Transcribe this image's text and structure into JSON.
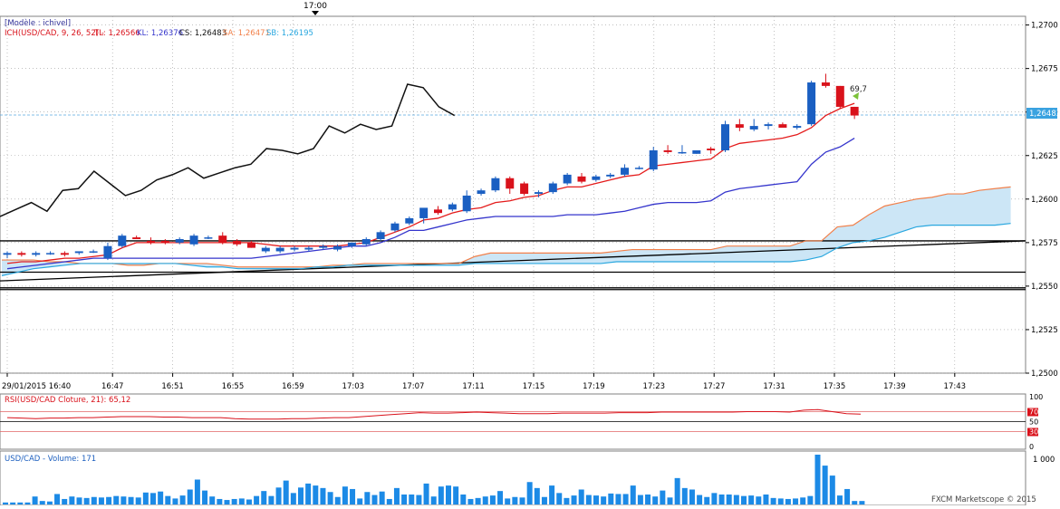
{
  "top_marker": {
    "label": "17:00",
    "time_index": 23
  },
  "legend": {
    "model": "[Modèle : ichivel]",
    "ich": "ICH(USD/CAD, 9, 26, 52) -",
    "tl": "TL: 1,26566",
    "kl": "KL: 1,26376",
    "cs": "CS: 1,26483",
    "sa": "SA: 1,26471",
    "sb": "SB: 1,26195"
  },
  "colors": {
    "bull": "#1a5fc2",
    "bear": "#d9121b",
    "tenkan": "#e41b1b",
    "kijun": "#3535cc",
    "chikou": "#111111",
    "senkou_a": "#f2804a",
    "senkou_b": "#29a7df",
    "cloud": "#cce6f6",
    "rsi": "#d9121b",
    "volume": "#1c8ae6",
    "grid": "#9a9a9a",
    "price_badge": "#3aa2e0"
  },
  "price_label": "1,26483",
  "rsi_legend": "RSI(USD/CAD Cloture, 21): 65,12",
  "volume_legend": "USD/CAD - Volume: 171",
  "volume_axis_label": "1 000",
  "footer": "FXCM Marketscope © 2015",
  "annotation": "69,7",
  "chart_data": [
    {
      "type": "candlestick",
      "title": "",
      "x_labels": [
        {
          "i": 0,
          "label": "29/01/2015 16:40"
        },
        {
          "i": 7,
          "label": "16:47"
        },
        {
          "i": 11,
          "label": "16:51"
        },
        {
          "i": 15,
          "label": "16:55"
        },
        {
          "i": 19,
          "label": "16:59"
        },
        {
          "i": 23,
          "label": "17:03"
        },
        {
          "i": 27,
          "label": "17:07"
        },
        {
          "i": 31,
          "label": "17:11"
        },
        {
          "i": 35,
          "label": "17:15"
        },
        {
          "i": 39,
          "label": "17:19"
        },
        {
          "i": 43,
          "label": "17:23"
        },
        {
          "i": 47,
          "label": "17:27"
        },
        {
          "i": 51,
          "label": "17:31"
        },
        {
          "i": 55,
          "label": "17:35"
        },
        {
          "i": 59,
          "label": "17:39"
        },
        {
          "i": 63,
          "label": "17:43"
        }
      ],
      "y_ticks": [
        "1,2700",
        "1,2675",
        "1,2650",
        "1,2625",
        "1,2600",
        "1,2575",
        "1,2550",
        "1,2525",
        "1,2500"
      ],
      "y_tick_values": [
        1.27,
        1.2675,
        1.265,
        1.2625,
        1.26,
        1.2575,
        1.255,
        1.2525,
        1.25
      ],
      "ylim": [
        1.25,
        1.2705
      ],
      "x_count": 66,
      "candles": [
        {
          "o": 1.2568,
          "h": 1.257,
          "l": 1.2566,
          "c": 1.2569
        },
        {
          "o": 1.2569,
          "h": 1.257,
          "l": 1.2567,
          "c": 1.2568
        },
        {
          "o": 1.2568,
          "h": 1.257,
          "l": 1.2567,
          "c": 1.2569
        },
        {
          "o": 1.2569,
          "h": 1.257,
          "l": 1.2568,
          "c": 1.2569
        },
        {
          "o": 1.2569,
          "h": 1.257,
          "l": 1.2567,
          "c": 1.2568
        },
        {
          "o": 1.2569,
          "h": 1.257,
          "l": 1.2568,
          "c": 1.257
        },
        {
          "o": 1.257,
          "h": 1.2571,
          "l": 1.2569,
          "c": 1.257
        },
        {
          "o": 1.2566,
          "h": 1.2575,
          "l": 1.2565,
          "c": 1.2573
        },
        {
          "o": 1.2573,
          "h": 1.258,
          "l": 1.2572,
          "c": 1.2579
        },
        {
          "o": 1.2578,
          "h": 1.2579,
          "l": 1.2577,
          "c": 1.2577
        },
        {
          "o": 1.2576,
          "h": 1.2578,
          "l": 1.2574,
          "c": 1.2575
        },
        {
          "o": 1.2576,
          "h": 1.2577,
          "l": 1.2574,
          "c": 1.2575
        },
        {
          "o": 1.2575,
          "h": 1.2578,
          "l": 1.2574,
          "c": 1.2577
        },
        {
          "o": 1.2574,
          "h": 1.258,
          "l": 1.2573,
          "c": 1.2579
        },
        {
          "o": 1.2578,
          "h": 1.2579,
          "l": 1.2577,
          "c": 1.2578
        },
        {
          "o": 1.2579,
          "h": 1.2581,
          "l": 1.2574,
          "c": 1.2575
        },
        {
          "o": 1.2576,
          "h": 1.2577,
          "l": 1.2573,
          "c": 1.2574
        },
        {
          "o": 1.2575,
          "h": 1.2576,
          "l": 1.2572,
          "c": 1.2572
        },
        {
          "o": 1.257,
          "h": 1.2573,
          "l": 1.2569,
          "c": 1.2572
        },
        {
          "o": 1.257,
          "h": 1.2573,
          "l": 1.2569,
          "c": 1.2572
        },
        {
          "o": 1.2571,
          "h": 1.2573,
          "l": 1.257,
          "c": 1.2572
        },
        {
          "o": 1.2571,
          "h": 1.2573,
          "l": 1.257,
          "c": 1.2572
        },
        {
          "o": 1.2572,
          "h": 1.2574,
          "l": 1.2571,
          "c": 1.2573
        },
        {
          "o": 1.2571,
          "h": 1.2574,
          "l": 1.257,
          "c": 1.2573
        },
        {
          "o": 1.2573,
          "h": 1.2575,
          "l": 1.2572,
          "c": 1.2575
        },
        {
          "o": 1.2574,
          "h": 1.2578,
          "l": 1.2573,
          "c": 1.2577
        },
        {
          "o": 1.2577,
          "h": 1.2582,
          "l": 1.2576,
          "c": 1.2581
        },
        {
          "o": 1.2582,
          "h": 1.2587,
          "l": 1.2581,
          "c": 1.2586
        },
        {
          "o": 1.2586,
          "h": 1.259,
          "l": 1.2585,
          "c": 1.2589
        },
        {
          "o": 1.2589,
          "h": 1.2593,
          "l": 1.2586,
          "c": 1.2595
        },
        {
          "o": 1.2594,
          "h": 1.2596,
          "l": 1.2591,
          "c": 1.2592
        },
        {
          "o": 1.2594,
          "h": 1.2598,
          "l": 1.2593,
          "c": 1.2597
        },
        {
          "o": 1.2593,
          "h": 1.2605,
          "l": 1.2592,
          "c": 1.2602
        },
        {
          "o": 1.2603,
          "h": 1.2606,
          "l": 1.2602,
          "c": 1.2605
        },
        {
          "o": 1.2605,
          "h": 1.2613,
          "l": 1.2604,
          "c": 1.2612
        },
        {
          "o": 1.2612,
          "h": 1.2613,
          "l": 1.2603,
          "c": 1.2606
        },
        {
          "o": 1.2609,
          "h": 1.261,
          "l": 1.2602,
          "c": 1.2603
        },
        {
          "o": 1.2603,
          "h": 1.2605,
          "l": 1.2601,
          "c": 1.2604
        },
        {
          "o": 1.2604,
          "h": 1.261,
          "l": 1.2603,
          "c": 1.2609
        },
        {
          "o": 1.2609,
          "h": 1.2615,
          "l": 1.2608,
          "c": 1.2614
        },
        {
          "o": 1.2613,
          "h": 1.2615,
          "l": 1.2609,
          "c": 1.261
        },
        {
          "o": 1.2611,
          "h": 1.2614,
          "l": 1.261,
          "c": 1.2613
        },
        {
          "o": 1.2613,
          "h": 1.2615,
          "l": 1.2612,
          "c": 1.2614
        },
        {
          "o": 1.2614,
          "h": 1.262,
          "l": 1.2613,
          "c": 1.2618
        },
        {
          "o": 1.2618,
          "h": 1.2619,
          "l": 1.2617,
          "c": 1.2618
        },
        {
          "o": 1.2617,
          "h": 1.263,
          "l": 1.2616,
          "c": 1.2628
        },
        {
          "o": 1.2628,
          "h": 1.2631,
          "l": 1.2626,
          "c": 1.2627
        },
        {
          "o": 1.2627,
          "h": 1.2631,
          "l": 1.2626,
          "c": 1.2627
        },
        {
          "o": 1.2626,
          "h": 1.2628,
          "l": 1.2626,
          "c": 1.2628
        },
        {
          "o": 1.2629,
          "h": 1.263,
          "l": 1.2626,
          "c": 1.2628
        },
        {
          "o": 1.2628,
          "h": 1.2645,
          "l": 1.2627,
          "c": 1.2643
        },
        {
          "o": 1.2643,
          "h": 1.2646,
          "l": 1.2639,
          "c": 1.2641
        },
        {
          "o": 1.264,
          "h": 1.2646,
          "l": 1.2639,
          "c": 1.2642
        },
        {
          "o": 1.2642,
          "h": 1.2644,
          "l": 1.264,
          "c": 1.2643
        },
        {
          "o": 1.2643,
          "h": 1.2644,
          "l": 1.2641,
          "c": 1.2641
        },
        {
          "o": 1.2641,
          "h": 1.2643,
          "l": 1.264,
          "c": 1.2642
        },
        {
          "o": 1.2643,
          "h": 1.2668,
          "l": 1.2642,
          "c": 1.2667
        },
        {
          "o": 1.2667,
          "h": 1.2672,
          "l": 1.2664,
          "c": 1.2665
        },
        {
          "o": 1.2665,
          "h": 1.2665,
          "l": 1.2652,
          "c": 1.2653
        },
        {
          "o": 1.2653,
          "h": 1.2653,
          "l": 1.2646,
          "c": 1.2648
        }
      ],
      "candle_x_offset": 0,
      "series": [
        {
          "name": "TL",
          "x_start": 0,
          "values": [
            1.2563,
            1.2564,
            1.2564,
            1.2565,
            1.2566,
            1.2566,
            1.2567,
            1.2568,
            1.2572,
            1.2575,
            1.2575,
            1.2575,
            1.2575,
            1.2575,
            1.2575,
            1.2575,
            1.2575,
            1.2575,
            1.2574,
            1.2573,
            1.2573,
            1.2573,
            1.2573,
            1.2573,
            1.2574,
            1.2575,
            1.2578,
            1.2581,
            1.2584,
            1.2588,
            1.2589,
            1.2592,
            1.2594,
            1.2595,
            1.2598,
            1.2599,
            1.2601,
            1.2602,
            1.2605,
            1.2607,
            1.2607,
            1.2609,
            1.2611,
            1.2613,
            1.2614,
            1.2619,
            1.262,
            1.2621,
            1.2622,
            1.2623,
            1.2629,
            1.2632,
            1.2633,
            1.2634,
            1.2635,
            1.2637,
            1.2641,
            1.2648,
            1.2652,
            1.2655
          ]
        },
        {
          "name": "KL",
          "x_start": 0,
          "values": [
            1.256,
            1.2561,
            1.2562,
            1.2563,
            1.2564,
            1.2565,
            1.2566,
            1.2566,
            1.2566,
            1.2566,
            1.2566,
            1.2566,
            1.2566,
            1.2566,
            1.2566,
            1.2566,
            1.2566,
            1.2566,
            1.2567,
            1.2568,
            1.2569,
            1.257,
            1.2571,
            1.2572,
            1.2573,
            1.2573,
            1.2575,
            1.2578,
            1.2582,
            1.2582,
            1.2584,
            1.2586,
            1.2588,
            1.2589,
            1.259,
            1.259,
            1.259,
            1.259,
            1.259,
            1.2591,
            1.2591,
            1.2591,
            1.2592,
            1.2593,
            1.2595,
            1.2597,
            1.2598,
            1.2598,
            1.2598,
            1.2599,
            1.2604,
            1.2606,
            1.2607,
            1.2608,
            1.2609,
            1.261,
            1.262,
            1.2627,
            1.263,
            1.2635
          ]
        },
        {
          "name": "CS",
          "x_start": 0,
          "values": [
            1.259,
            1.2594,
            1.2598,
            1.2593,
            1.2605,
            1.2606,
            1.2616,
            1.2609,
            1.2602,
            1.2605,
            1.2611,
            1.2614,
            1.2618,
            1.2612,
            1.2615,
            1.2618,
            1.262,
            1.2629,
            1.2628,
            1.2626,
            1.2629,
            1.2642,
            1.2638,
            1.2643,
            1.264,
            1.2642,
            1.2666,
            1.2664,
            1.2653,
            1.2648
          ]
        },
        {
          "name": "SA",
          "x_start": 0,
          "values": [
            1.2565,
            1.2565,
            1.2565,
            1.2564,
            1.2564,
            1.2563,
            1.2563,
            1.2563,
            1.2562,
            1.2562,
            1.2563,
            1.2563,
            1.2563,
            1.2563,
            1.2562,
            1.2561,
            1.2561,
            1.2561,
            1.2561,
            1.2561,
            1.2561,
            1.2562,
            1.2562,
            1.2563,
            1.2563,
            1.2563,
            1.2563,
            1.2563,
            1.2563,
            1.2563,
            1.2567,
            1.2569,
            1.2569,
            1.2569,
            1.2569,
            1.2569,
            1.2569,
            1.2569,
            1.2569,
            1.257,
            1.2571,
            1.2571,
            1.2571,
            1.2571,
            1.2571,
            1.2571,
            1.2573,
            1.2573,
            1.2573,
            1.2573,
            1.2573,
            1.2576,
            1.2576,
            1.2584,
            1.2585,
            1.2591,
            1.2596,
            1.2598,
            1.26,
            1.2601,
            1.2603,
            1.2603,
            1.2605,
            1.2606,
            1.2607
          ]
        },
        {
          "name": "SB",
          "x_start": 0,
          "values": [
            1.2556,
            1.2558,
            1.256,
            1.2561,
            1.2562,
            1.2563,
            1.2563,
            1.2563,
            1.2563,
            1.2563,
            1.2563,
            1.2563,
            1.2562,
            1.2561,
            1.2561,
            1.256,
            1.256,
            1.256,
            1.256,
            1.256,
            1.2561,
            1.2561,
            1.2562,
            1.2562,
            1.2562,
            1.2562,
            1.2562,
            1.2562,
            1.2562,
            1.2562,
            1.2563,
            1.2563,
            1.2563,
            1.2563,
            1.2563,
            1.2563,
            1.2563,
            1.2563,
            1.2563,
            1.2564,
            1.2564,
            1.2564,
            1.2564,
            1.2564,
            1.2564,
            1.2564,
            1.2564,
            1.2564,
            1.2564,
            1.2564,
            1.2564,
            1.2565,
            1.2567,
            1.2572,
            1.2575,
            1.2576,
            1.2578,
            1.2581,
            1.2584,
            1.2585,
            1.2585,
            1.2585,
            1.2585,
            1.2585,
            1.2586
          ]
        }
      ],
      "horizontal_lines": [
        1.2576,
        1.2558,
        1.2549,
        1.2548
      ],
      "trend_line": {
        "from": [
          0,
          1.2553
        ],
        "to": [
          65,
          1.2576
        ]
      },
      "current_price": 1.26483
    },
    {
      "type": "line",
      "title": "RSI(USD/CAD Cloture, 21): 65,12",
      "y_ticks": [
        "100",
        "70",
        "50",
        "30",
        "0"
      ],
      "y_tick_values": [
        100,
        70,
        50,
        30,
        0
      ],
      "ylim": [
        0,
        100
      ],
      "levels": [
        70,
        50,
        30
      ],
      "series": [
        {
          "name": "RSI",
          "x_start": 0,
          "values": [
            58,
            57,
            56,
            57,
            57,
            58,
            58,
            59,
            60,
            60,
            60,
            59,
            59,
            58,
            58,
            58,
            56,
            55,
            55,
            55,
            56,
            56,
            57,
            58,
            58,
            60,
            62,
            64,
            66,
            68,
            67,
            67,
            68,
            69,
            68,
            67,
            66,
            66,
            66,
            67,
            67,
            67,
            67,
            68,
            68,
            68,
            69,
            69,
            69,
            69,
            69,
            69,
            70,
            70,
            70,
            69,
            73,
            74,
            70,
            66,
            65
          ]
        }
      ]
    },
    {
      "type": "bar",
      "title": "USD/CAD - Volume: 171",
      "ylim": [
        0,
        1000
      ],
      "y_ticks": [
        "1 000"
      ],
      "values": [
        40,
        40,
        40,
        40,
        160,
        70,
        60,
        210,
        110,
        160,
        140,
        130,
        150,
        140,
        150,
        170,
        160,
        150,
        140,
        240,
        230,
        260,
        170,
        120,
        180,
        300,
        500,
        280,
        160,
        110,
        90,
        110,
        120,
        100,
        170,
        270,
        170,
        340,
        480,
        230,
        340,
        420,
        380,
        330,
        250,
        150,
        360,
        310,
        120,
        250,
        190,
        260,
        110,
        330,
        200,
        200,
        190,
        420,
        160,
        360,
        380,
        360,
        200,
        110,
        130,
        160,
        180,
        270,
        120,
        150,
        140,
        450,
        330,
        150,
        380,
        230,
        130,
        180,
        300,
        190,
        180,
        160,
        220,
        210,
        210,
        380,
        190,
        200,
        160,
        280,
        140,
        530,
        330,
        300,
        190,
        150,
        230,
        200,
        200,
        190,
        170,
        180,
        160,
        200,
        130,
        120,
        110,
        120,
        140,
        170,
        1000,
        780,
        580,
        180,
        310,
        70,
        70
      ]
    }
  ]
}
